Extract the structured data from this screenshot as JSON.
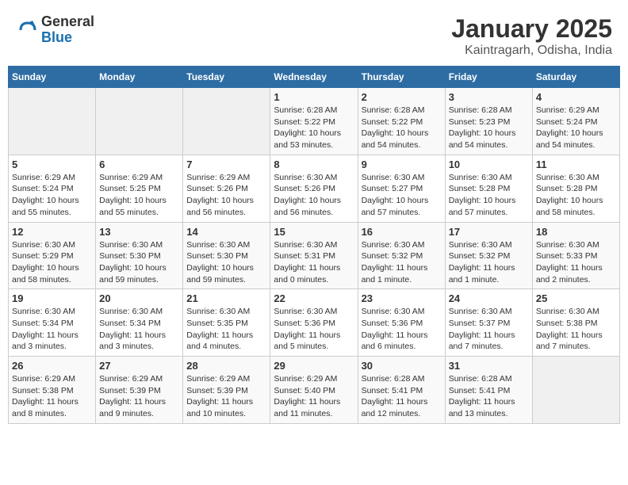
{
  "header": {
    "logo_general": "General",
    "logo_blue": "Blue",
    "title": "January 2025",
    "subtitle": "Kaintragarh, Odisha, India"
  },
  "weekdays": [
    "Sunday",
    "Monday",
    "Tuesday",
    "Wednesday",
    "Thursday",
    "Friday",
    "Saturday"
  ],
  "weeks": [
    [
      {
        "day": "",
        "info": ""
      },
      {
        "day": "",
        "info": ""
      },
      {
        "day": "",
        "info": ""
      },
      {
        "day": "1",
        "info": "Sunrise: 6:28 AM\nSunset: 5:22 PM\nDaylight: 10 hours\nand 53 minutes."
      },
      {
        "day": "2",
        "info": "Sunrise: 6:28 AM\nSunset: 5:22 PM\nDaylight: 10 hours\nand 54 minutes."
      },
      {
        "day": "3",
        "info": "Sunrise: 6:28 AM\nSunset: 5:23 PM\nDaylight: 10 hours\nand 54 minutes."
      },
      {
        "day": "4",
        "info": "Sunrise: 6:29 AM\nSunset: 5:24 PM\nDaylight: 10 hours\nand 54 minutes."
      }
    ],
    [
      {
        "day": "5",
        "info": "Sunrise: 6:29 AM\nSunset: 5:24 PM\nDaylight: 10 hours\nand 55 minutes."
      },
      {
        "day": "6",
        "info": "Sunrise: 6:29 AM\nSunset: 5:25 PM\nDaylight: 10 hours\nand 55 minutes."
      },
      {
        "day": "7",
        "info": "Sunrise: 6:29 AM\nSunset: 5:26 PM\nDaylight: 10 hours\nand 56 minutes."
      },
      {
        "day": "8",
        "info": "Sunrise: 6:30 AM\nSunset: 5:26 PM\nDaylight: 10 hours\nand 56 minutes."
      },
      {
        "day": "9",
        "info": "Sunrise: 6:30 AM\nSunset: 5:27 PM\nDaylight: 10 hours\nand 57 minutes."
      },
      {
        "day": "10",
        "info": "Sunrise: 6:30 AM\nSunset: 5:28 PM\nDaylight: 10 hours\nand 57 minutes."
      },
      {
        "day": "11",
        "info": "Sunrise: 6:30 AM\nSunset: 5:28 PM\nDaylight: 10 hours\nand 58 minutes."
      }
    ],
    [
      {
        "day": "12",
        "info": "Sunrise: 6:30 AM\nSunset: 5:29 PM\nDaylight: 10 hours\nand 58 minutes."
      },
      {
        "day": "13",
        "info": "Sunrise: 6:30 AM\nSunset: 5:30 PM\nDaylight: 10 hours\nand 59 minutes."
      },
      {
        "day": "14",
        "info": "Sunrise: 6:30 AM\nSunset: 5:30 PM\nDaylight: 10 hours\nand 59 minutes."
      },
      {
        "day": "15",
        "info": "Sunrise: 6:30 AM\nSunset: 5:31 PM\nDaylight: 11 hours\nand 0 minutes."
      },
      {
        "day": "16",
        "info": "Sunrise: 6:30 AM\nSunset: 5:32 PM\nDaylight: 11 hours\nand 1 minute."
      },
      {
        "day": "17",
        "info": "Sunrise: 6:30 AM\nSunset: 5:32 PM\nDaylight: 11 hours\nand 1 minute."
      },
      {
        "day": "18",
        "info": "Sunrise: 6:30 AM\nSunset: 5:33 PM\nDaylight: 11 hours\nand 2 minutes."
      }
    ],
    [
      {
        "day": "19",
        "info": "Sunrise: 6:30 AM\nSunset: 5:34 PM\nDaylight: 11 hours\nand 3 minutes."
      },
      {
        "day": "20",
        "info": "Sunrise: 6:30 AM\nSunset: 5:34 PM\nDaylight: 11 hours\nand 3 minutes."
      },
      {
        "day": "21",
        "info": "Sunrise: 6:30 AM\nSunset: 5:35 PM\nDaylight: 11 hours\nand 4 minutes."
      },
      {
        "day": "22",
        "info": "Sunrise: 6:30 AM\nSunset: 5:36 PM\nDaylight: 11 hours\nand 5 minutes."
      },
      {
        "day": "23",
        "info": "Sunrise: 6:30 AM\nSunset: 5:36 PM\nDaylight: 11 hours\nand 6 minutes."
      },
      {
        "day": "24",
        "info": "Sunrise: 6:30 AM\nSunset: 5:37 PM\nDaylight: 11 hours\nand 7 minutes."
      },
      {
        "day": "25",
        "info": "Sunrise: 6:30 AM\nSunset: 5:38 PM\nDaylight: 11 hours\nand 7 minutes."
      }
    ],
    [
      {
        "day": "26",
        "info": "Sunrise: 6:29 AM\nSunset: 5:38 PM\nDaylight: 11 hours\nand 8 minutes."
      },
      {
        "day": "27",
        "info": "Sunrise: 6:29 AM\nSunset: 5:39 PM\nDaylight: 11 hours\nand 9 minutes."
      },
      {
        "day": "28",
        "info": "Sunrise: 6:29 AM\nSunset: 5:39 PM\nDaylight: 11 hours\nand 10 minutes."
      },
      {
        "day": "29",
        "info": "Sunrise: 6:29 AM\nSunset: 5:40 PM\nDaylight: 11 hours\nand 11 minutes."
      },
      {
        "day": "30",
        "info": "Sunrise: 6:28 AM\nSunset: 5:41 PM\nDaylight: 11 hours\nand 12 minutes."
      },
      {
        "day": "31",
        "info": "Sunrise: 6:28 AM\nSunset: 5:41 PM\nDaylight: 11 hours\nand 13 minutes."
      },
      {
        "day": "",
        "info": ""
      }
    ]
  ]
}
